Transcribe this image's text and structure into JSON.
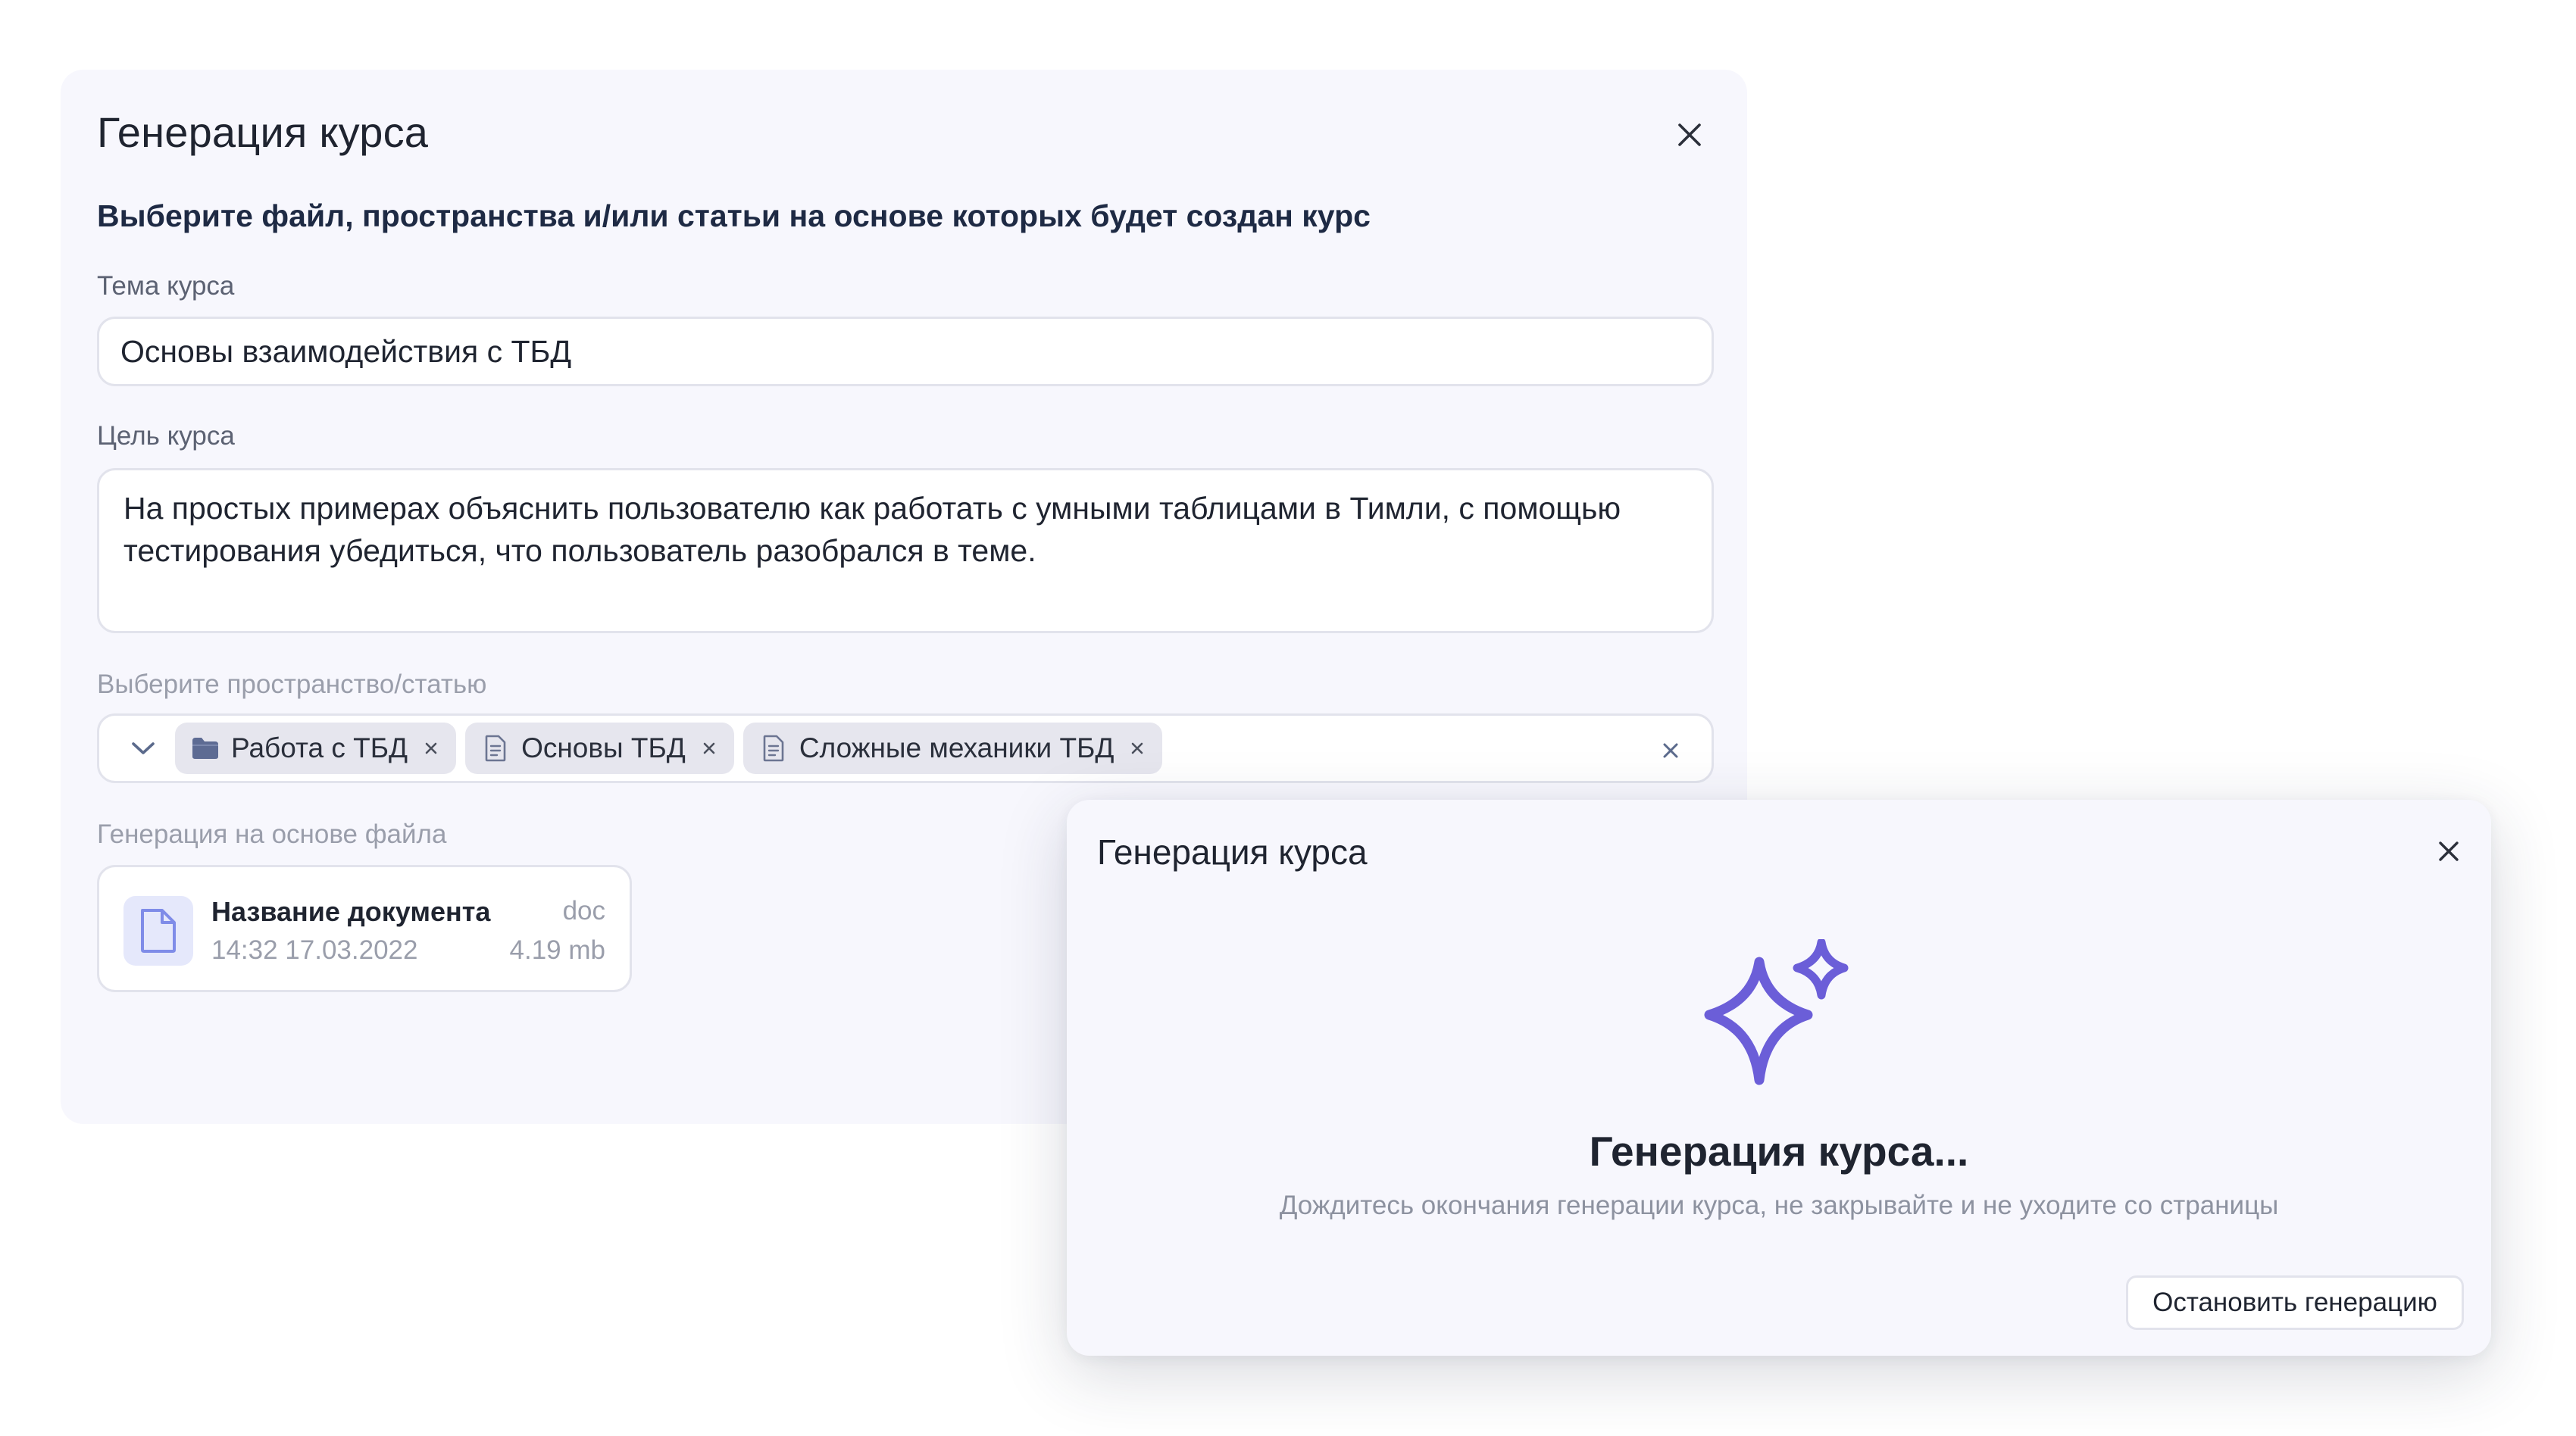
{
  "course_form": {
    "title": "Генерация курса",
    "subtitle": "Выберите файл, пространства и/или статьи на основе которых будет создан курс",
    "topic_label": "Тема курса",
    "topic_value": "Основы взаимодействия с ТБД",
    "goal_label": "Цель курса",
    "goal_value": "На простых примерах объяснить пользователю как работать с умными таблицами в Тимли, с помощью тестирования убедиться, что пользователь разобрался в теме.",
    "source_label": "Выберите пространство/статью",
    "chips": [
      {
        "label": "Работа с ТБД",
        "icon": "folder-icon"
      },
      {
        "label": "Основы ТБД",
        "icon": "document-icon"
      },
      {
        "label": "Сложные механики ТБД",
        "icon": "document-icon"
      }
    ],
    "file_label": "Генерация на основе файла",
    "file": {
      "name": "Название документа",
      "type": "doc",
      "date": "14:32 17.03.2022",
      "size": "4.19 mb"
    }
  },
  "generation_modal": {
    "title": "Генерация курса",
    "heading": "Генерация курса...",
    "description": "Дождитесь окончания генерации курса, не закрывайте и не уходите со страницы",
    "stop_button": "Остановить генерацию",
    "icon": "sparkle-icon",
    "accent_color": "#6b5ed8"
  }
}
